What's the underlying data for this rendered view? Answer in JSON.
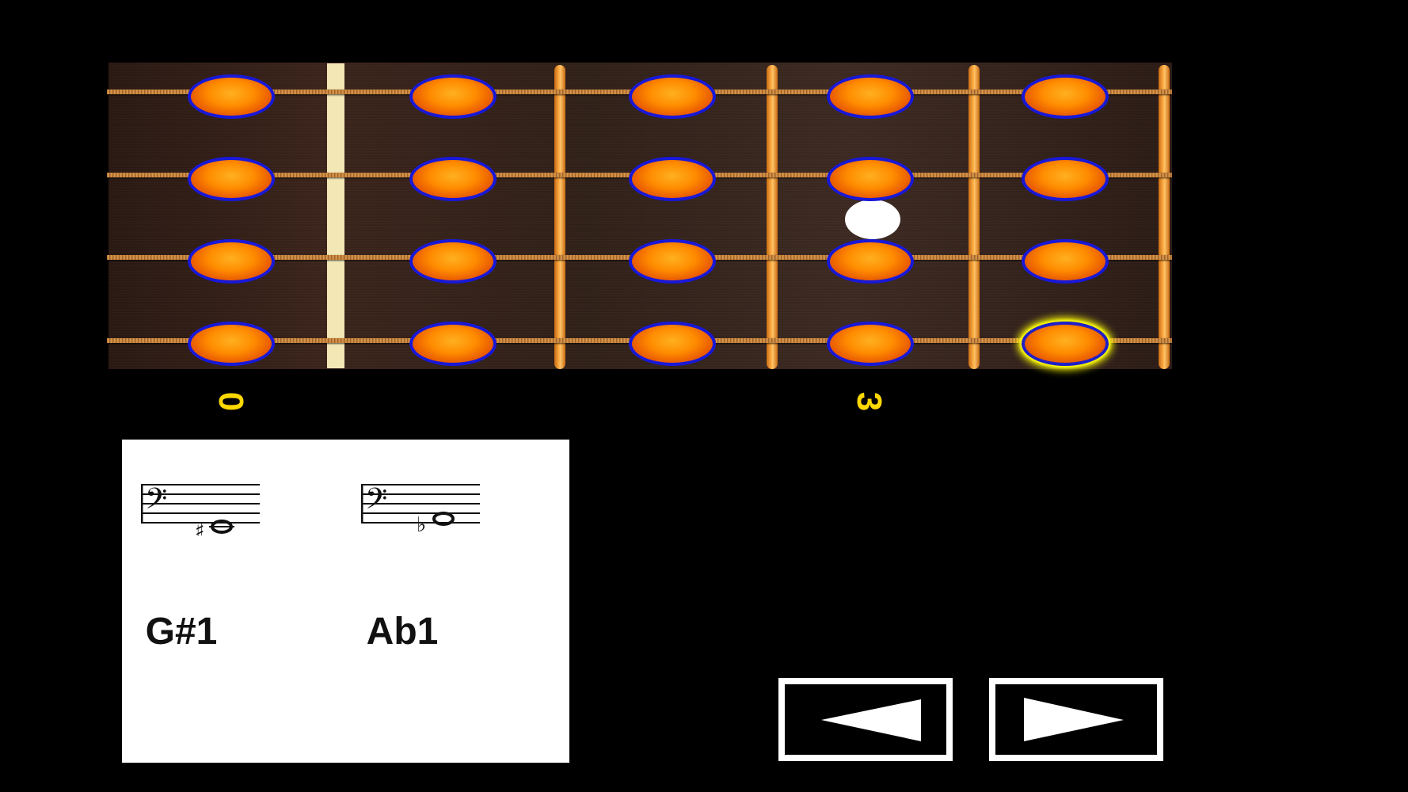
{
  "fretboard": {
    "fret_numbers": [
      "0",
      "3"
    ],
    "strings": 4,
    "fret_positions": 6,
    "selected_note": {
      "string": 4,
      "position": 6
    },
    "colors": {
      "note_fill": "#ff8c00",
      "note_border": "#1818d8",
      "highlight": "#ffff00",
      "fret": "#ffa030",
      "nut": "#f3e7b6"
    }
  },
  "note_panel": {
    "notes": [
      {
        "name": "G#1",
        "accidental": "sharp"
      },
      {
        "name": "Ab1",
        "accidental": "flat"
      }
    ]
  },
  "navigation": {
    "prev_icon": "left-triangle-icon",
    "next_icon": "right-triangle-icon"
  }
}
